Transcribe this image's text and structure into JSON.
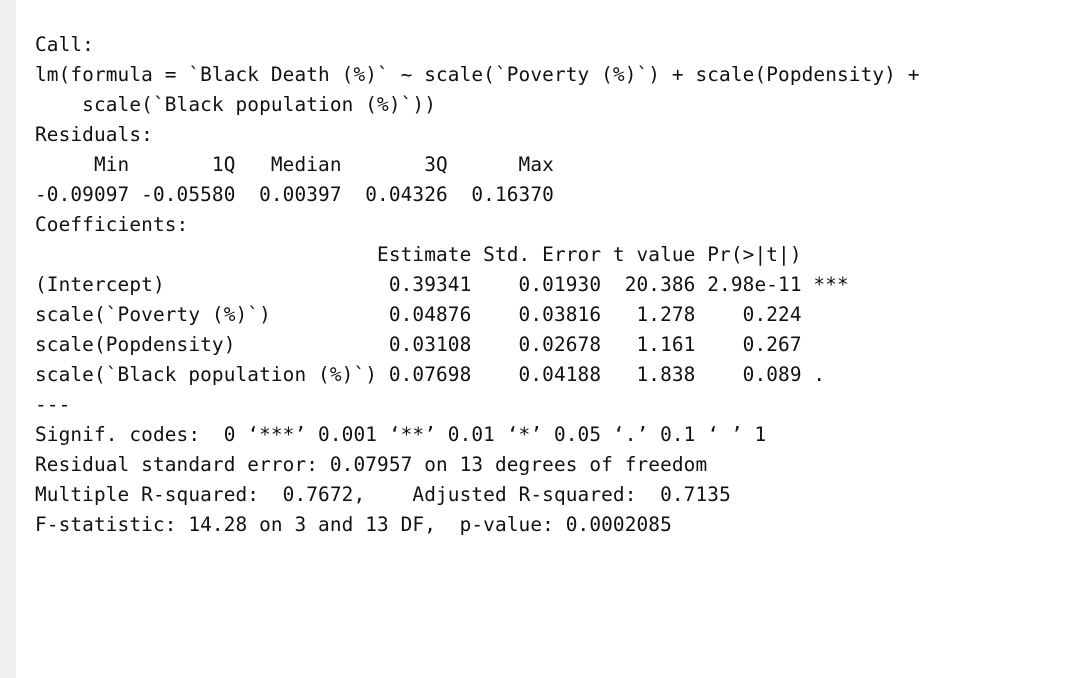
{
  "console": {
    "lines": [
      "Call:",
      "lm(formula = `Black Death (%)` ~ scale(`Poverty (%)`) + scale(Popdensity) + ",
      "    scale(`Black population (%)`))",
      "",
      "Residuals:",
      "     Min       1Q   Median       3Q      Max ",
      "-0.09097 -0.05580  0.00397  0.04326  0.16370 ",
      "",
      "Coefficients:",
      "                             Estimate Std. Error t value Pr(>|t|)    ",
      "(Intercept)                   0.39341    0.01930  20.386 2.98e-11 ***",
      "scale(`Poverty (%)`)          0.04876    0.03816   1.278    0.224    ",
      "scale(Popdensity)             0.03108    0.02678   1.161    0.267    ",
      "scale(`Black population (%)`) 0.07698    0.04188   1.838    0.089 .  ",
      "---",
      "Signif. codes:  0 ‘***’ 0.001 ‘**’ 0.01 ‘*’ 0.05 ‘.’ 0.1 ‘ ’ 1",
      "",
      "Residual standard error: 0.07957 on 13 degrees of freedom",
      "Multiple R-squared:  0.7672,\tAdjusted R-squared:  0.7135 ",
      "F-statistic: 14.28 on 3 and 13 DF,  p-value: 0.0002085"
    ]
  }
}
